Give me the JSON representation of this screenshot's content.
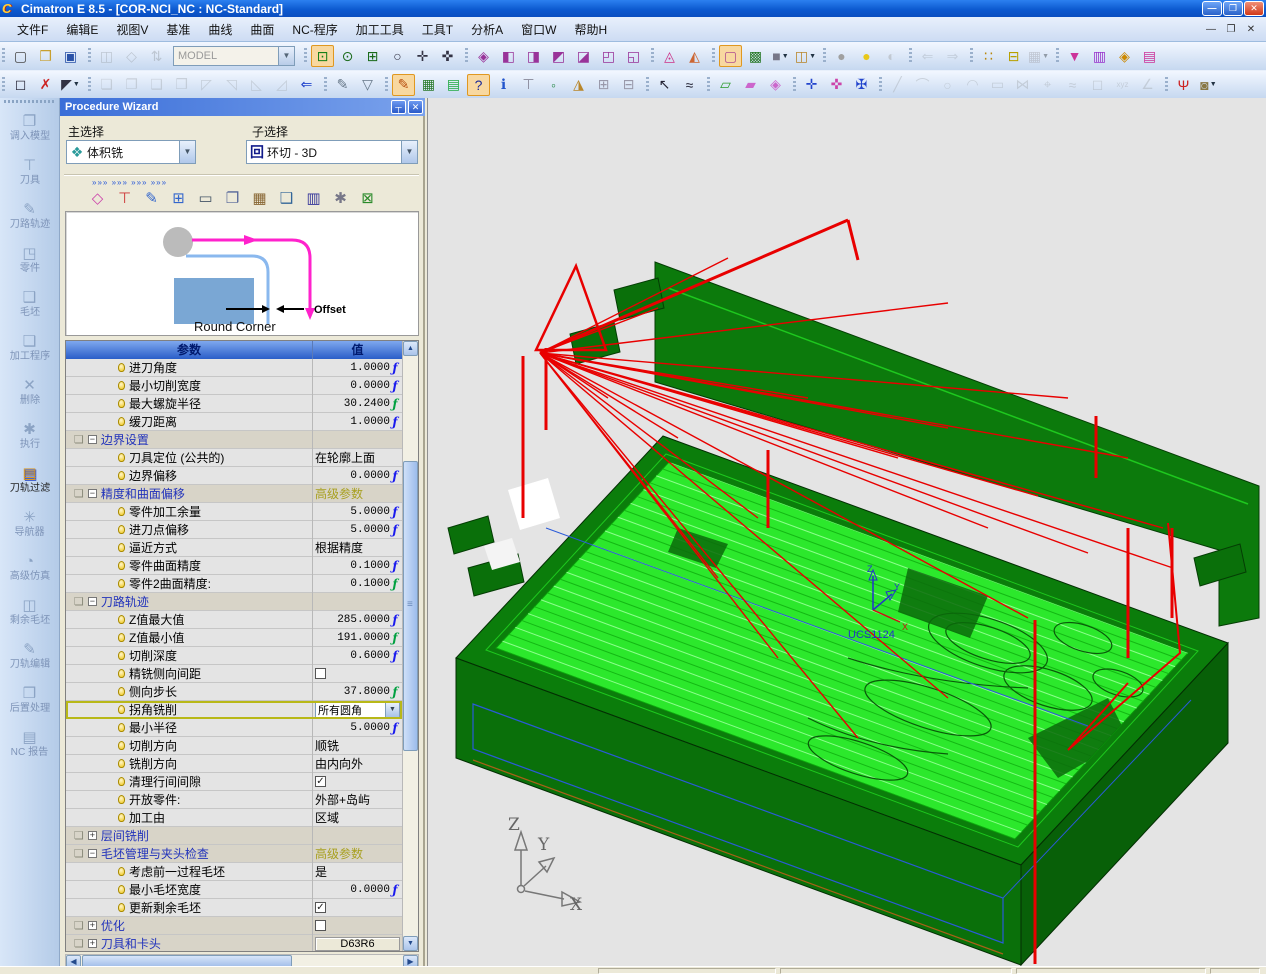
{
  "window": {
    "logo_glyph": "C",
    "title": "Cimatron E 8.5 - [COR-NCI_NC : NC-Standard]",
    "buttons": [
      {
        "name": "minimize-button",
        "glyph": "—"
      },
      {
        "name": "restore-button",
        "glyph": "❐"
      },
      {
        "name": "close-button",
        "glyph": "✕"
      }
    ],
    "mdi_buttons": [
      {
        "name": "mdi-minimize-button",
        "glyph": "—"
      },
      {
        "name": "mdi-restore-button",
        "glyph": "❐"
      },
      {
        "name": "mdi-close-button",
        "glyph": "✕"
      }
    ]
  },
  "menu": {
    "items": [
      {
        "label": "文件F"
      },
      {
        "label": "编辑E"
      },
      {
        "label": "视图V"
      },
      {
        "label": "基准"
      },
      {
        "label": "曲线"
      },
      {
        "label": "曲面"
      },
      {
        "label": "NC-程序"
      },
      {
        "label": "加工工具"
      },
      {
        "label": "工具T"
      },
      {
        "label": "分析A"
      },
      {
        "label": "窗口W"
      },
      {
        "label": "帮助H"
      }
    ]
  },
  "toolbar1": {
    "model_combo_value": "MODEL",
    "groups": [
      {
        "icons": [
          {
            "n": "new-file-icon",
            "g": "▢",
            "c": "#4a4a4a"
          },
          {
            "n": "open-folder-icon",
            "g": "❒",
            "c": "#c8a030"
          },
          {
            "n": "save-icon",
            "g": "▣",
            "c": "#2a52a8"
          }
        ]
      },
      {
        "icons": [
          {
            "n": "load-ref-model-icon",
            "g": "◫",
            "c": "#8899aa",
            "dis": true
          },
          {
            "n": "facet-model-icon",
            "g": "◇",
            "c": "#8899aa",
            "dis": true
          },
          {
            "n": "update-model-icon",
            "g": "⇅",
            "c": "#8899aa",
            "dis": true
          },
          {
            "n": "model-combobox",
            "combo": true
          }
        ]
      },
      {
        "icons": [
          {
            "n": "zoom-fit-icon",
            "g": "⊡",
            "c": "#188018",
            "hl": true
          },
          {
            "n": "zoom-dynamic-icon",
            "g": "⊙",
            "c": "#1a6a1a"
          },
          {
            "n": "zoom-window-icon",
            "g": "⊞",
            "c": "#1a6a1a"
          },
          {
            "n": "zoom-icon",
            "g": "○",
            "c": "#333344"
          },
          {
            "n": "pan-icon",
            "g": "✛",
            "c": "#333344"
          },
          {
            "n": "rotate-view-icon",
            "g": "✜",
            "c": "#333344"
          }
        ]
      },
      {
        "icons": [
          {
            "n": "iso-view-icon",
            "g": "◈",
            "c": "#993399"
          },
          {
            "n": "front-view-icon",
            "g": "◧",
            "c": "#993399"
          },
          {
            "n": "back-view-icon",
            "g": "◨",
            "c": "#993399"
          },
          {
            "n": "top-view-icon",
            "g": "◩",
            "c": "#993399"
          },
          {
            "n": "bottom-view-icon",
            "g": "◪",
            "c": "#993399"
          },
          {
            "n": "left-view-icon",
            "g": "◰",
            "c": "#993399"
          },
          {
            "n": "right-view-icon",
            "g": "◱",
            "c": "#993399"
          }
        ]
      },
      {
        "icons": [
          {
            "n": "view-previous-icon",
            "g": "◬",
            "c": "#cc3388"
          },
          {
            "n": "view-store-icon",
            "g": "◭",
            "c": "#cc6633"
          }
        ]
      },
      {
        "icons": [
          {
            "n": "wireframe-icon",
            "g": "▢",
            "c": "#b05090",
            "hl": true
          },
          {
            "n": "shaded-icon",
            "g": "▩",
            "c": "#2a7a2a"
          },
          {
            "n": "hidden-line-icon",
            "g": "■",
            "c": "#777788",
            "dd": true
          },
          {
            "n": "clip-view-icon",
            "g": "◫",
            "c": "#b8862a",
            "dd": true
          }
        ]
      },
      {
        "icons": [
          {
            "n": "light-off-icon",
            "g": "●",
            "c": "#a0a0a0"
          },
          {
            "n": "light-on-icon",
            "g": "●",
            "c": "#e8c81a"
          },
          {
            "n": "light-pick-icon",
            "g": "◐",
            "c": "#a0a0a0",
            "dis": true
          }
        ]
      },
      {
        "icons": [
          {
            "n": "view-back-icon",
            "g": "⇐",
            "c": "#9ab0cc",
            "dis": true
          },
          {
            "n": "view-forward-icon",
            "g": "⇒",
            "c": "#9ab0cc",
            "dis": true
          }
        ]
      },
      {
        "icons": [
          {
            "n": "point-snap-icon",
            "g": "∷",
            "c": "#b8860b"
          },
          {
            "n": "measure-icon",
            "g": "⊟",
            "c": "#b8a000"
          },
          {
            "n": "attach-table-icon",
            "g": "▦",
            "c": "#9999aa",
            "dis": true,
            "dd": true
          }
        ]
      },
      {
        "icons": [
          {
            "n": "nc-tool-icon",
            "g": "▼",
            "c": "#cc3399"
          },
          {
            "n": "nc-holder-icon",
            "g": "▥",
            "c": "#9933cc"
          },
          {
            "n": "nc-tool-table-icon",
            "g": "◈",
            "c": "#cc8800"
          },
          {
            "n": "nc-machine-icon",
            "g": "▤",
            "c": "#cc3399"
          }
        ]
      }
    ]
  },
  "toolbar2": {
    "groups": [
      {
        "icons": [
          {
            "n": "pick-box-icon",
            "g": "◻",
            "c": "#333344"
          },
          {
            "n": "pick-cancel-icon",
            "g": "✗",
            "c": "#cc2222"
          },
          {
            "n": "pick-filter-icon",
            "g": "◤",
            "c": "#333344",
            "dd": true
          }
        ]
      },
      {
        "icons": [
          {
            "n": "copy-geometry-icon",
            "g": "❏",
            "c": "#99aabb",
            "dis": true
          },
          {
            "n": "move-geometry-icon",
            "g": "❐",
            "c": "#99aabb",
            "dis": true
          },
          {
            "n": "mirror-geometry-icon",
            "g": "❑",
            "c": "#99aabb",
            "dis": true
          },
          {
            "n": "scale-geometry-icon",
            "g": "❒",
            "c": "#99aabb",
            "dis": true
          },
          {
            "n": "delete-geometry-icon",
            "g": "◸",
            "c": "#99aabb",
            "dis": true
          },
          {
            "n": "trim-geometry-icon",
            "g": "◹",
            "c": "#99aabb",
            "dis": true
          },
          {
            "n": "extend-geometry-icon",
            "g": "◺",
            "c": "#99aabb",
            "dis": true
          },
          {
            "n": "offset-geometry-icon",
            "g": "◿",
            "c": "#99aabb",
            "dis": true
          },
          {
            "n": "return-icon",
            "g": "⇐",
            "c": "#2244cc"
          }
        ]
      },
      {
        "icons": [
          {
            "n": "annotate-icon",
            "g": "✎",
            "c": "#667788"
          },
          {
            "n": "filter-funnel-icon",
            "g": "▽",
            "c": "#667788"
          }
        ]
      },
      {
        "icons": [
          {
            "n": "procedure-manager-icon",
            "g": "✎",
            "c": "#b85010",
            "hl": true
          },
          {
            "n": "tool-manager-icon",
            "g": "▦",
            "c": "#2a7a2a"
          },
          {
            "n": "parameter-list-icon",
            "g": "▤",
            "c": "#22aa44"
          },
          {
            "n": "context-help-icon",
            "g": "?",
            "c": "#1a2a9a",
            "hl": true
          },
          {
            "n": "info-icon",
            "g": "ℹ",
            "c": "#2255cc"
          },
          {
            "n": "pin-object-icon",
            "g": "⊤",
            "c": "#888899"
          },
          {
            "n": "node-pick-icon",
            "g": "◦",
            "c": "#2a8a4a"
          },
          {
            "n": "solid-fillet-icon",
            "g": "◮",
            "c": "#b8862a"
          },
          {
            "n": "split-horizontal-icon",
            "g": "⊞",
            "c": "#9999aa"
          },
          {
            "n": "split-vertical-icon",
            "g": "⊟",
            "c": "#9999aa"
          }
        ]
      },
      {
        "icons": [
          {
            "n": "select-arrow-icon",
            "g": "↖",
            "c": "#222233"
          },
          {
            "n": "polyline-pick-icon",
            "g": "≈",
            "c": "#222233"
          }
        ]
      },
      {
        "icons": [
          {
            "n": "plane-green-icon",
            "g": "▱",
            "c": "#2a9a2a"
          },
          {
            "n": "plane-pink-icon",
            "g": "▰",
            "c": "#cc66cc"
          },
          {
            "n": "mesh-pink-icon",
            "g": "◈",
            "c": "#cc66cc"
          }
        ]
      },
      {
        "icons": [
          {
            "n": "axes-blue-icon",
            "g": "✛",
            "c": "#2244cc"
          },
          {
            "n": "axes-pink-icon",
            "g": "✜",
            "c": "#cc44aa"
          },
          {
            "n": "axes-move-icon",
            "g": "✠",
            "c": "#2244cc"
          }
        ]
      },
      {
        "icons": [
          {
            "n": "line-tool-icon",
            "g": "╱",
            "c": "#99aabb",
            "dis": true
          },
          {
            "n": "arc-tool-icon",
            "g": "⌒",
            "c": "#99aabb",
            "dis": true
          },
          {
            "n": "circle-tool-icon",
            "g": "○",
            "c": "#99aabb",
            "dis": true
          },
          {
            "n": "fillet-tool-icon",
            "g": "◠",
            "c": "#99aabb",
            "dis": true
          },
          {
            "n": "rect-tool-icon",
            "g": "▭",
            "c": "#99aabb",
            "dis": true
          },
          {
            "n": "trim-tool-icon",
            "g": "⋈",
            "c": "#99aabb",
            "dis": true
          },
          {
            "n": "point-tool-icon",
            "g": "⌖",
            "c": "#99aabb",
            "dis": true
          },
          {
            "n": "spline-tool-icon",
            "g": "≈",
            "c": "#99aabb",
            "dis": true
          },
          {
            "n": "ucs-box-icon",
            "g": "◻",
            "c": "#99aabb",
            "dis": true
          },
          {
            "n": "xyz-coords-icon",
            "g": "xyz",
            "c": "#99aabb",
            "dis": true,
            "small": true
          },
          {
            "n": "angle-tool-icon",
            "g": "∠",
            "c": "#99aabb",
            "dis": true
          }
        ]
      },
      {
        "icons": [
          {
            "n": "ucs-icon",
            "g": "Ψ",
            "c": "#cc2222"
          },
          {
            "n": "render-mode-icon",
            "g": "◙",
            "c": "#887744",
            "dd": true
          }
        ]
      }
    ]
  },
  "sidebar": {
    "items": [
      {
        "label": "调入模型",
        "icon": "load-model-icon",
        "g": "❐"
      },
      {
        "label": "刀具",
        "icon": "cutter-icon",
        "g": "⊤"
      },
      {
        "label": "刀路轨迹",
        "icon": "toolpath-icon",
        "g": "✎"
      },
      {
        "label": "零件",
        "icon": "part-icon",
        "g": "◳"
      },
      {
        "label": "毛坯",
        "icon": "stock-icon",
        "g": "❑"
      },
      {
        "label": "加工程序",
        "icon": "procedures-icon",
        "g": "❏"
      },
      {
        "label": "删除",
        "icon": "delete-icon",
        "g": "✕"
      },
      {
        "label": "执行",
        "icon": "execute-icon",
        "g": "✱"
      },
      {
        "label": "刀轨过滤",
        "icon": "toolpath-filter-icon",
        "g": "▤",
        "active": true
      },
      {
        "label": "导航器",
        "icon": "navigator-icon",
        "g": "✳"
      },
      {
        "label": "高级仿真",
        "icon": "simulation-icon",
        "g": "◔"
      },
      {
        "label": "剩余毛坯",
        "icon": "rest-stock-icon",
        "g": "◫"
      },
      {
        "label": "刀轨编辑",
        "icon": "toolpath-edit-icon",
        "g": "✎"
      },
      {
        "label": "后置处理",
        "icon": "post-process-icon",
        "g": "❒"
      },
      {
        "label": "NC 报告",
        "icon": "nc-report-icon",
        "g": "▤"
      }
    ]
  },
  "wizard": {
    "title": "Procedure Wizard",
    "pin_glyph": "┬",
    "close_glyph": "✕",
    "main_select_label": "主选择",
    "sub_select_label": "子选择",
    "main_select_value": "体积铣",
    "main_select_icon": "❖",
    "sub_select_value": "环切 - 3D",
    "sub_select_icon": "回",
    "dotted_arrows": "»»»  »»»  »»»  »»»",
    "proc_icons": [
      {
        "n": "wiz-geometry-icon",
        "g": "◇",
        "c": "#cc44aa"
      },
      {
        "n": "wiz-tool-icon",
        "g": "⊤",
        "c": "#cc3333"
      },
      {
        "n": "wiz-contour-icon",
        "g": "✎",
        "c": "#3366cc"
      },
      {
        "n": "wiz-boundary-icon",
        "g": "⊞",
        "c": "#3366cc"
      },
      {
        "n": "wiz-preview-icon",
        "g": "▭",
        "c": "#445566"
      },
      {
        "n": "wiz-parameters-icon",
        "g": "❐",
        "c": "#556699"
      },
      {
        "n": "wiz-calculate-icon",
        "g": "▦",
        "c": "#886633"
      },
      {
        "n": "wiz-simulate-icon",
        "g": "❑",
        "c": "#336699"
      },
      {
        "n": "wiz-save-icon",
        "g": "▥",
        "c": "#333399"
      },
      {
        "n": "wiz-batch-icon",
        "g": "✱",
        "c": "#777788"
      },
      {
        "n": "wiz-exit-icon",
        "g": "⊠",
        "c": "#2a8a2a"
      }
    ],
    "diagram": {
      "caption": "Round Corner",
      "offset_label": "Offset"
    },
    "table": {
      "col_param": "参数",
      "col_value": "值",
      "f_glyph": "ƒ",
      "rows": [
        {
          "t": "p",
          "label": "进刀角度",
          "value": "1.0000",
          "f": "b"
        },
        {
          "t": "p",
          "label": "最小切削宽度",
          "value": "0.0000",
          "f": "b"
        },
        {
          "t": "p",
          "label": "最大螺旋半径",
          "value": "30.2400",
          "f": "g"
        },
        {
          "t": "p",
          "label": "缓刀距离",
          "value": "1.0000",
          "f": "b"
        },
        {
          "t": "g",
          "exp": "-",
          "label": "边界设置",
          "value": ""
        },
        {
          "t": "p",
          "label": "刀具定位 (公共的)",
          "value": "在轮廓上面",
          "align": "l"
        },
        {
          "t": "p",
          "label": "边界偏移",
          "value": "0.0000",
          "f": "b"
        },
        {
          "t": "g",
          "exp": "-",
          "label": "精度和曲面偏移",
          "value": "高级参数",
          "adv": true
        },
        {
          "t": "p",
          "label": "零件加工余量",
          "value": "5.0000",
          "f": "b"
        },
        {
          "t": "p",
          "label": "进刀点偏移",
          "value": "5.0000",
          "f": "b"
        },
        {
          "t": "p",
          "label": "逼近方式",
          "value": "根据精度",
          "align": "l"
        },
        {
          "t": "p",
          "label": "零件曲面精度",
          "value": "0.1000",
          "f": "b"
        },
        {
          "t": "p",
          "label": "零件2曲面精度:",
          "value": "0.1000",
          "f": "g"
        },
        {
          "t": "g",
          "exp": "-",
          "label": "刀路轨迹",
          "value": ""
        },
        {
          "t": "p",
          "label": "Z值最大值",
          "value": "285.0000",
          "f": "b"
        },
        {
          "t": "p",
          "label": "Z值最小值",
          "value": "191.0000",
          "f": "g"
        },
        {
          "t": "p",
          "label": "切削深度",
          "value": "0.6000",
          "f": "b"
        },
        {
          "t": "p",
          "label": "精铣侧向间距",
          "ctrl": "cb0"
        },
        {
          "t": "p",
          "label": "侧向步长",
          "value": "37.8000",
          "f": "g"
        },
        {
          "t": "p",
          "label": "拐角铣削",
          "value": "所有圆角",
          "ctrl": "dd",
          "sel": true
        },
        {
          "t": "p",
          "label": "最小半径",
          "value": "5.0000",
          "f": "b"
        },
        {
          "t": "p",
          "label": "切削方向",
          "value": "顺铣",
          "align": "l"
        },
        {
          "t": "p",
          "label": "铣削方向",
          "value": "由内向外",
          "align": "l"
        },
        {
          "t": "p",
          "label": "清理行间间隙",
          "ctrl": "cb1"
        },
        {
          "t": "p",
          "label": "开放零件:",
          "value": "外部+岛屿",
          "align": "l"
        },
        {
          "t": "p",
          "label": "加工由",
          "value": "区域",
          "align": "l"
        },
        {
          "t": "g",
          "exp": "+",
          "label": "层间铣削",
          "value": ""
        },
        {
          "t": "g",
          "exp": "-",
          "label": "毛坯管理与夹头检查",
          "value": "高级参数",
          "adv": true
        },
        {
          "t": "p",
          "label": "考虑前一过程毛坯",
          "value": "是",
          "align": "l"
        },
        {
          "t": "p",
          "label": "最小毛坯宽度",
          "value": "0.0000",
          "f": "b"
        },
        {
          "t": "p",
          "label": "更新剩余毛坯",
          "ctrl": "cb1"
        },
        {
          "t": "g",
          "exp": "+",
          "label": "优化",
          "ctrl": "cb0"
        },
        {
          "t": "g",
          "exp": "+",
          "label": "刀具和卡头",
          "value": "D63R6",
          "ctrl": "btn"
        }
      ]
    }
  },
  "viewport": {
    "ucs_label": "UCS1124",
    "axis": {
      "x": "X",
      "y": "Y",
      "z": "Z"
    },
    "colors": {
      "background": "#e4e4e4",
      "block_green": "#0b7d0b",
      "toolpath_lime": "#2ce82c",
      "rapid_red": "#e80000",
      "outline_blue": "#2a5ad8",
      "outline_orange": "#a86018"
    }
  }
}
